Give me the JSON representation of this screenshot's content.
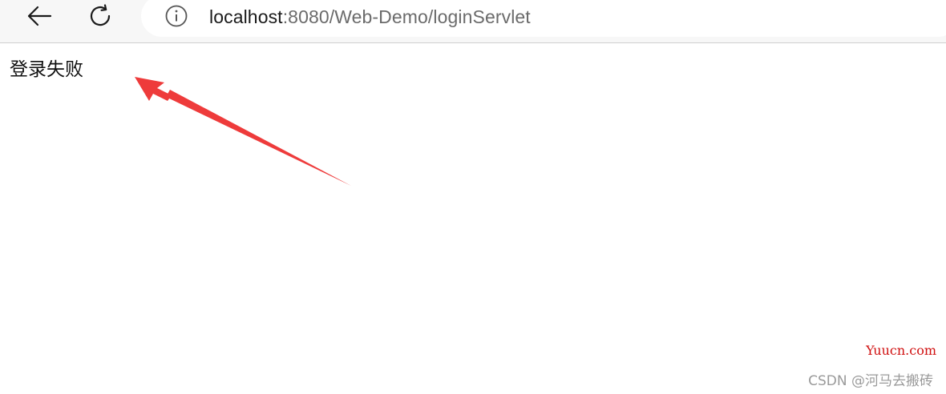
{
  "browser": {
    "back_icon": "arrow-left-icon",
    "reload_icon": "reload-icon",
    "info_icon": "info-icon",
    "url_host": "localhost",
    "url_rest": ":8080/Web-Demo/loginServlet"
  },
  "page": {
    "message": "登录失败"
  },
  "annotation": {
    "arrow_color": "#ee3b3b"
  },
  "watermarks": {
    "site": "Yuucn.com",
    "csdn": "CSDN @河马去搬砖"
  }
}
